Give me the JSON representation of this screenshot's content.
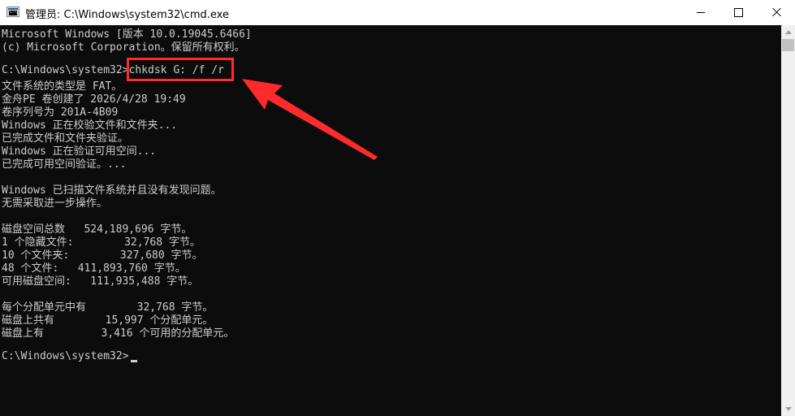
{
  "window": {
    "title": "管理员: C:\\Windows\\system32\\cmd.exe",
    "icon": "cmd-icon",
    "buttons": {
      "minimize": "minimize-icon",
      "maximize": "maximize-icon",
      "close": "close-icon"
    }
  },
  "console": {
    "lines": [
      "Microsoft Windows [版本 10.0.19045.6466]",
      "(c) Microsoft Corporation。保留所有权利。",
      "",
      "C:\\Windows\\system32>chkdsk G: /f /r",
      "文件系统的类型是 FAT。",
      "金舟PE 卷创建了 2026/4/28 19:49",
      "卷序列号为 201A-4B09",
      "Windows 正在校验文件和文件夹...",
      "已完成文件和文件夹验证。",
      "Windows 正在验证可用空间...",
      "已完成可用空间验证。...",
      "",
      "Windows 已扫描文件系统并且没有发现问题。",
      "无需采取进一步操作。",
      "",
      "磁盘空间总数   524,189,696 字节。",
      "1 个隐藏文件:        32,768 字节。",
      "10 个文件夹:        327,680 字节。",
      "48 个文件:   411,893,760 字节。",
      "可用磁盘空间:   111,935,488 字节。",
      "",
      "每个分配单元中有        32,768 字节。",
      "磁盘上共有        15,997 个分配单元。",
      "磁盘上有         3,416 个可用的分配单元。",
      "",
      "C:\\Windows\\system32>"
    ],
    "text_color": "#cccccc",
    "background": "#0c0c0c"
  },
  "annotation": {
    "highlight_color": "#ff2a2a",
    "arrow_color": "#ff2a2a"
  }
}
